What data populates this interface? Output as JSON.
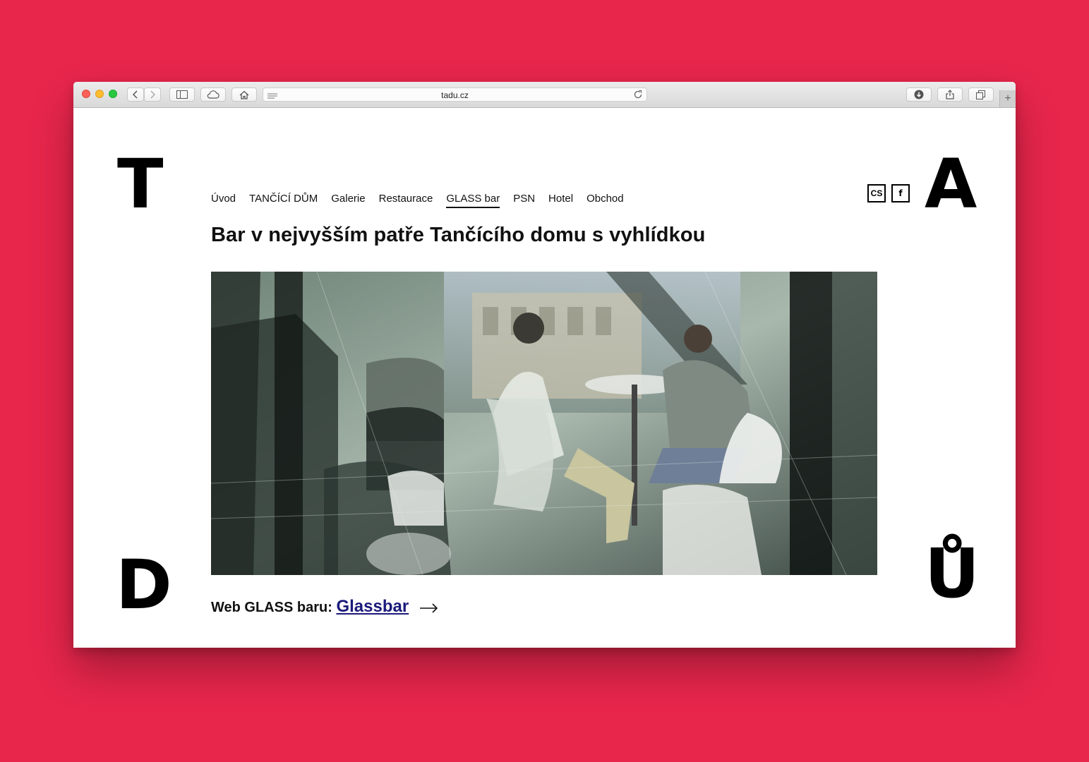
{
  "browser": {
    "url": "tadu.cz",
    "new_tab_label": "+"
  },
  "logo": {
    "top_left": "T",
    "top_right": "A",
    "bottom_left": "D",
    "bottom_right": "Ů"
  },
  "nav": {
    "items": [
      {
        "label": "Úvod",
        "active": false
      },
      {
        "label": "TANČÍCÍ DŮM",
        "active": false
      },
      {
        "label": "Galerie",
        "active": false
      },
      {
        "label": "Restaurace",
        "active": false
      },
      {
        "label": "GLASS bar",
        "active": true
      },
      {
        "label": "PSN",
        "active": false
      },
      {
        "label": "Hotel",
        "active": false
      },
      {
        "label": "Obchod",
        "active": false
      }
    ]
  },
  "header_tools": {
    "language": "CS",
    "facebook": "f"
  },
  "main": {
    "title": "Bar v nejvyšším patře Tančícího domu s vyhlídkou",
    "weblink_prefix": "Web GLASS baru:",
    "weblink_label": "Glassbar"
  },
  "colors": {
    "background": "#e8264c",
    "link": "#1a1a7a"
  }
}
